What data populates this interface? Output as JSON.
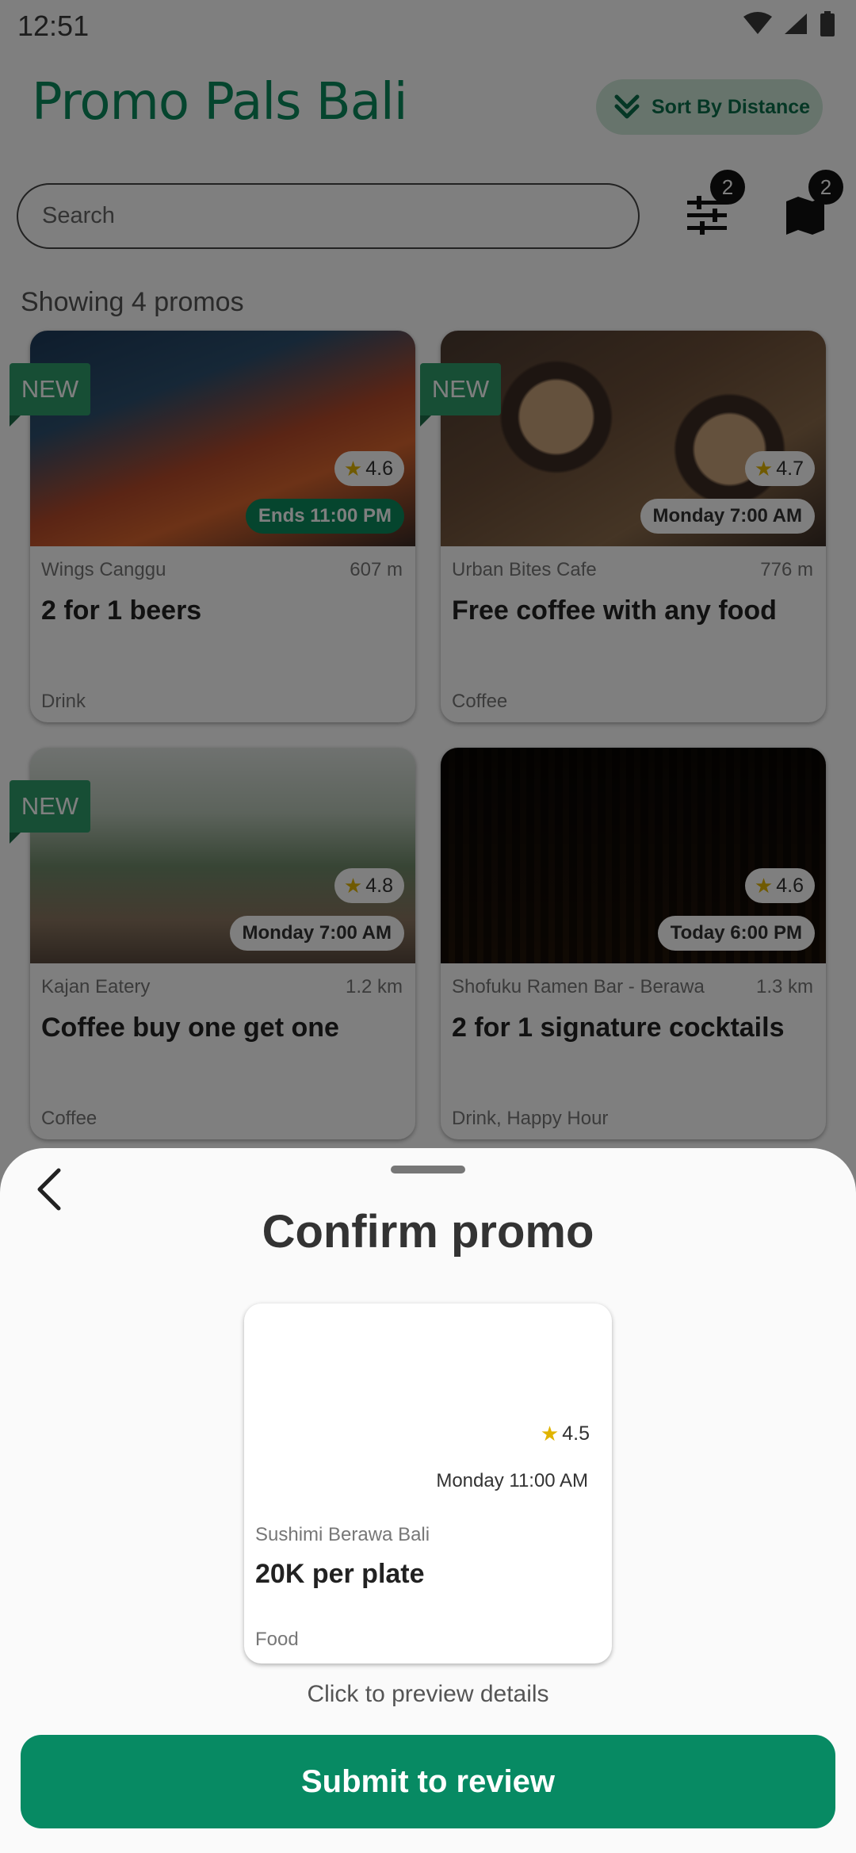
{
  "status_bar": {
    "time": "12:51"
  },
  "header": {
    "app_title": "Promo Pals Bali",
    "sort_label": "Sort By Distance"
  },
  "search": {
    "placeholder": "Search",
    "filter_badge": "2",
    "map_badge": "2"
  },
  "results": {
    "showing_text": "Showing 4 promos"
  },
  "promos": [
    {
      "new_label": "NEW",
      "rating": "4.6",
      "time": "Ends 11:00 PM",
      "time_style": "green",
      "venue": "Wings Canggu",
      "distance": "607 m",
      "title": "2 for 1 beers",
      "category": "Drink"
    },
    {
      "new_label": "NEW",
      "rating": "4.7",
      "time": "Monday 7:00 AM",
      "time_style": "white",
      "venue": "Urban Bites Cafe",
      "distance": "776 m",
      "title": "Free coffee with any food",
      "category": "Coffee"
    },
    {
      "new_label": "NEW",
      "rating": "4.8",
      "time": "Monday 7:00 AM",
      "time_style": "white",
      "venue": "Kajan Eatery",
      "distance": "1.2 km",
      "title": "Coffee buy one get one",
      "category": "Coffee"
    },
    {
      "new_label": "",
      "rating": "4.6",
      "time": "Today 6:00 PM",
      "time_style": "white",
      "venue": "Shofuku Ramen Bar - Berawa",
      "distance": "1.3 km",
      "title": "2 for 1 signature cocktails",
      "category": "Drink, Happy Hour"
    }
  ],
  "sheet": {
    "title": "Confirm promo",
    "card": {
      "rating": "4.5",
      "time": "Monday 11:00 AM",
      "venue": "Sushimi Berawa Bali",
      "title": "20K per plate",
      "category": "Food"
    },
    "hint": "Click to preview details",
    "submit_label": "Submit to review"
  },
  "colors": {
    "brand_green": "#0a8a5c",
    "button_green": "#078a63",
    "sort_bg": "#cfe8d9",
    "ribbon_green": "#2e9d6a"
  }
}
